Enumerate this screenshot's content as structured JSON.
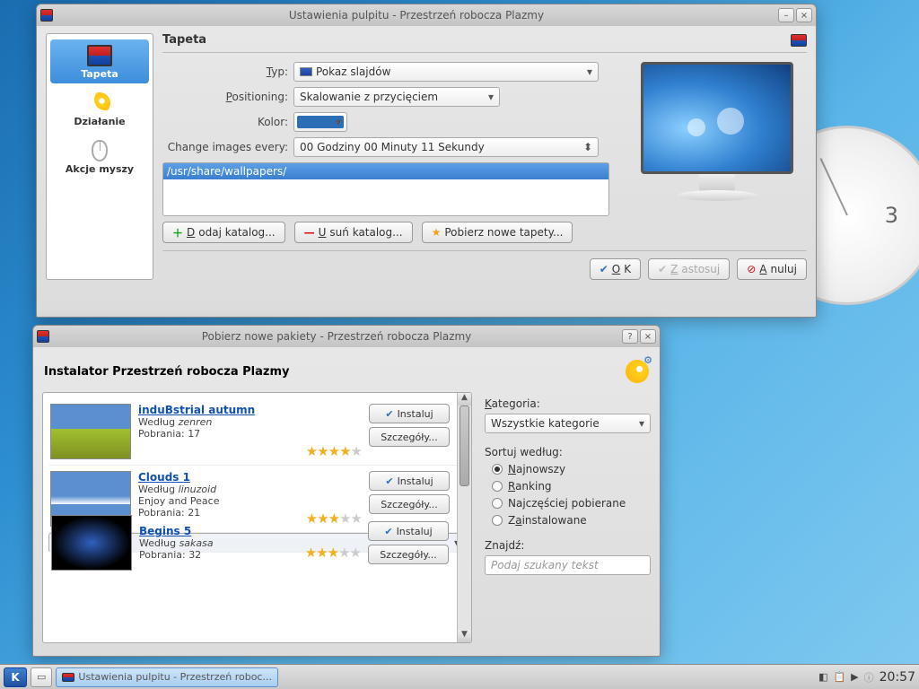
{
  "win1": {
    "title": "Ustawienia pulpitu - Przestrzeń robocza Plazmy",
    "sidebar": {
      "tapeta": "Tapeta",
      "dzialanie": "Działanie",
      "akcje": "Akcje myszy"
    },
    "section": "Tapeta",
    "labels": {
      "typ": "Typ:",
      "positioning": "Positioning:",
      "kolor": "Kolor:",
      "change": "Change images every:"
    },
    "typVal": "Pokaz slajdów",
    "posVal": "Skalowanie z przycięciem",
    "intervalVal": "00 Godziny 00 Minuty 11 Sekundy",
    "path": "/usr/share/wallpapers/",
    "btns": {
      "add": "Dodaj katalog...",
      "del": "Usuń katalog...",
      "get": "Pobierz nowe tapety...",
      "ok": "OK",
      "apply": "Zastosuj",
      "cancel": "Anuluj"
    }
  },
  "win2": {
    "title": "Pobierz nowe pakiety - Przestrzeń robocza Plazmy",
    "header": "Instalator Przestrzeń robocza Plazmy",
    "items": [
      {
        "name": "induBstrial autumn",
        "by": "Według",
        "author": "zenren",
        "dl": "Pobrania: 17",
        "stars": 4
      },
      {
        "name": "Clouds 1",
        "by": "Według",
        "author": "linuzoid",
        "sub": "Enjoy and Peace",
        "dl": "Pobrania: 21",
        "stars": 3
      },
      {
        "name": "Begins 5",
        "by": "Według",
        "author": "sakasa",
        "dl": "Pobrania: 32",
        "stars": 3
      }
    ],
    "btns": {
      "install": "Instaluj",
      "details": "Szczegóły..."
    },
    "side": {
      "cat": "Kategoria:",
      "catVal": "Wszystkie kategorie",
      "sort": "Sortuj według:",
      "r1": "Najnowszy",
      "r2": "Ranking",
      "r3": "Najczęściej pobierane",
      "r4": "Zainstalowane",
      "find": "Znajdź:",
      "placeholder": "Podaj szukany tekst"
    }
  },
  "taskbar": {
    "task": "Ustawienia pulpitu - Przestrzeń roboc...",
    "clock": "20:57"
  }
}
